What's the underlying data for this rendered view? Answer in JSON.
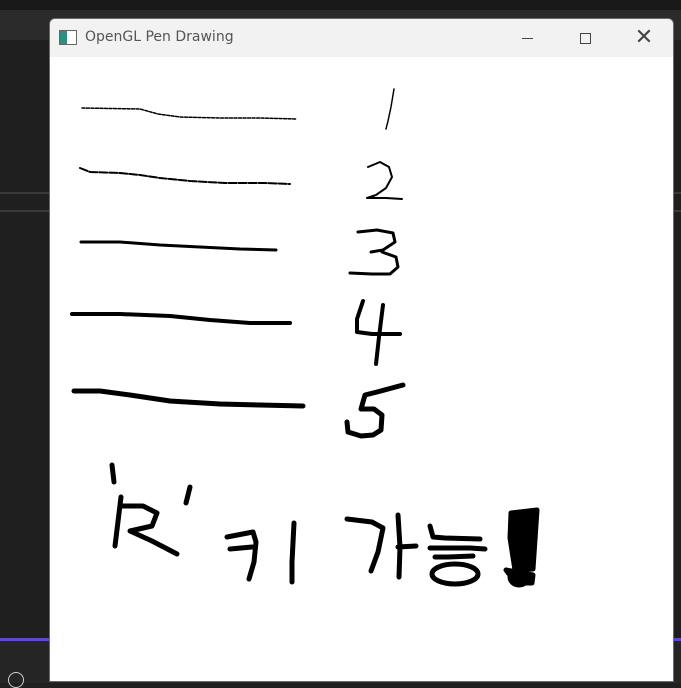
{
  "window": {
    "title": "OpenGL Pen Drawing",
    "app_icon": "opengl-app-icon",
    "controls": {
      "minimize_icon": "minimize-icon",
      "maximize_icon": "maximize-icon",
      "close_icon": "close-icon",
      "close_glyph": "✕"
    }
  },
  "canvas": {
    "background": "#ffffff",
    "ink_color": "#000000",
    "strokes": [
      {
        "name": "stroke-width-1",
        "width": 1,
        "label": "1"
      },
      {
        "name": "stroke-width-2",
        "width": 2,
        "label": "2"
      },
      {
        "name": "stroke-width-3",
        "width": 3,
        "label": "3"
      },
      {
        "name": "stroke-width-4",
        "width": 4,
        "label": "4"
      },
      {
        "name": "stroke-width-5",
        "width": 5,
        "label": "5"
      }
    ],
    "handwritten_message": "'R'키 가능!"
  },
  "desktop": {
    "accent": "#5b4bd1"
  }
}
